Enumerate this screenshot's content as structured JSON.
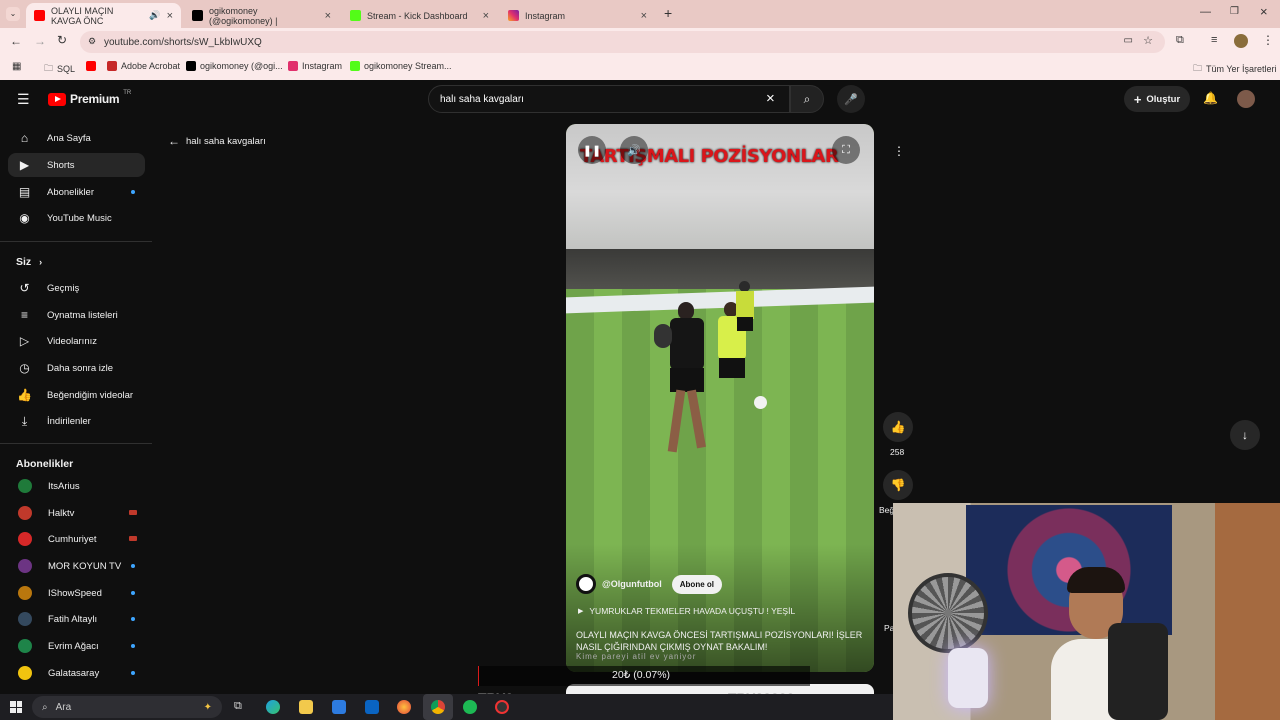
{
  "browser": {
    "tabs": [
      {
        "title": "OLAYLI MAÇIN KAVGA ÖNC",
        "color": "#ff0000"
      },
      {
        "title": "ogikomoney (@ogikomoney) |",
        "color": "#000000"
      },
      {
        "title": "Stream - Kick Dashboard",
        "color": "#53fc18"
      },
      {
        "title": "Instagram",
        "color": "#e1306c"
      }
    ],
    "url": "youtube.com/shorts/sW_LkbIwUXQ",
    "bookmarks": [
      {
        "label": "SQL"
      },
      {
        "label": ""
      },
      {
        "label": "Adobe Acrobat"
      },
      {
        "label": "ogikomoney (@ogi..."
      },
      {
        "label": "Instagram"
      },
      {
        "label": "ogikomoney Stream..."
      }
    ],
    "all_bookmarks": "Tüm Yer İşaretleri"
  },
  "yt": {
    "logo": "Premium",
    "logo_region": "TR",
    "search_value": "halı saha kavgaları",
    "create_label": "Oluştur",
    "back_label": "halı saha kavgaları",
    "nav": [
      {
        "label": "Ana Sayfa",
        "icon": "home-icon"
      },
      {
        "label": "Shorts",
        "icon": "shorts-icon"
      },
      {
        "label": "Abonelikler",
        "icon": "subscriptions-icon"
      },
      {
        "label": "YouTube Music",
        "icon": "music-icon"
      }
    ],
    "you_section": "Siz",
    "you_items": [
      {
        "label": "Geçmiş",
        "icon": "history-icon"
      },
      {
        "label": "Oynatma listeleri",
        "icon": "playlist-icon"
      },
      {
        "label": "Videolarınız",
        "icon": "your-videos-icon"
      },
      {
        "label": "Daha sonra izle",
        "icon": "watch-later-icon"
      },
      {
        "label": "Beğendiğim videolar",
        "icon": "like-icon"
      },
      {
        "label": "İndirilenler",
        "icon": "download-icon"
      }
    ],
    "subs_section": "Abonelikler",
    "subs": [
      {
        "label": "ItsArius",
        "color": "#1f7a3a",
        "badge": "none"
      },
      {
        "label": "Halktv",
        "color": "#c0392b",
        "badge": "live"
      },
      {
        "label": "Cumhuriyet",
        "color": "#d62828",
        "badge": "live"
      },
      {
        "label": "MOR KOYUN TV",
        "color": "#6c3483",
        "badge": "dot"
      },
      {
        "label": "IShowSpeed",
        "color": "#b9770e",
        "badge": "dot"
      },
      {
        "label": "Fatih Altaylı",
        "color": "#34495e",
        "badge": "dot"
      },
      {
        "label": "Evrim Ağacı",
        "color": "#1e8449",
        "badge": "dot"
      },
      {
        "label": "Galatasaray",
        "color": "#f1c40f",
        "badge": "dot"
      }
    ]
  },
  "short": {
    "overlay_title": "TARTIŞMALI POZİSYONLAR",
    "channel": "@Olgunfutbol",
    "subscribe_label": "Abone ol",
    "music": "YUMRUKLAR TEKMELER HAVADA UÇUŞTU ! YEŞİL",
    "description": "OLAYLI MAÇIN KAVGA ÖNCESİ TARTIŞMALI POZİSYONLARI! İŞLER NASIL ÇIĞIRINDAN ÇIKMIŞ OYNAT BAKALIM!",
    "subtitle": "Kime pareyi atil ev yaniyor",
    "like_count": "258",
    "dislike_label": "Beğ",
    "share_label": "Pa"
  },
  "stream_overlay": {
    "progress_text": "20₺ (0.07%)",
    "left_code": "TRY0",
    "right_code": "TRY29999"
  },
  "taskbar": {
    "search_placeholder": "Ara"
  }
}
